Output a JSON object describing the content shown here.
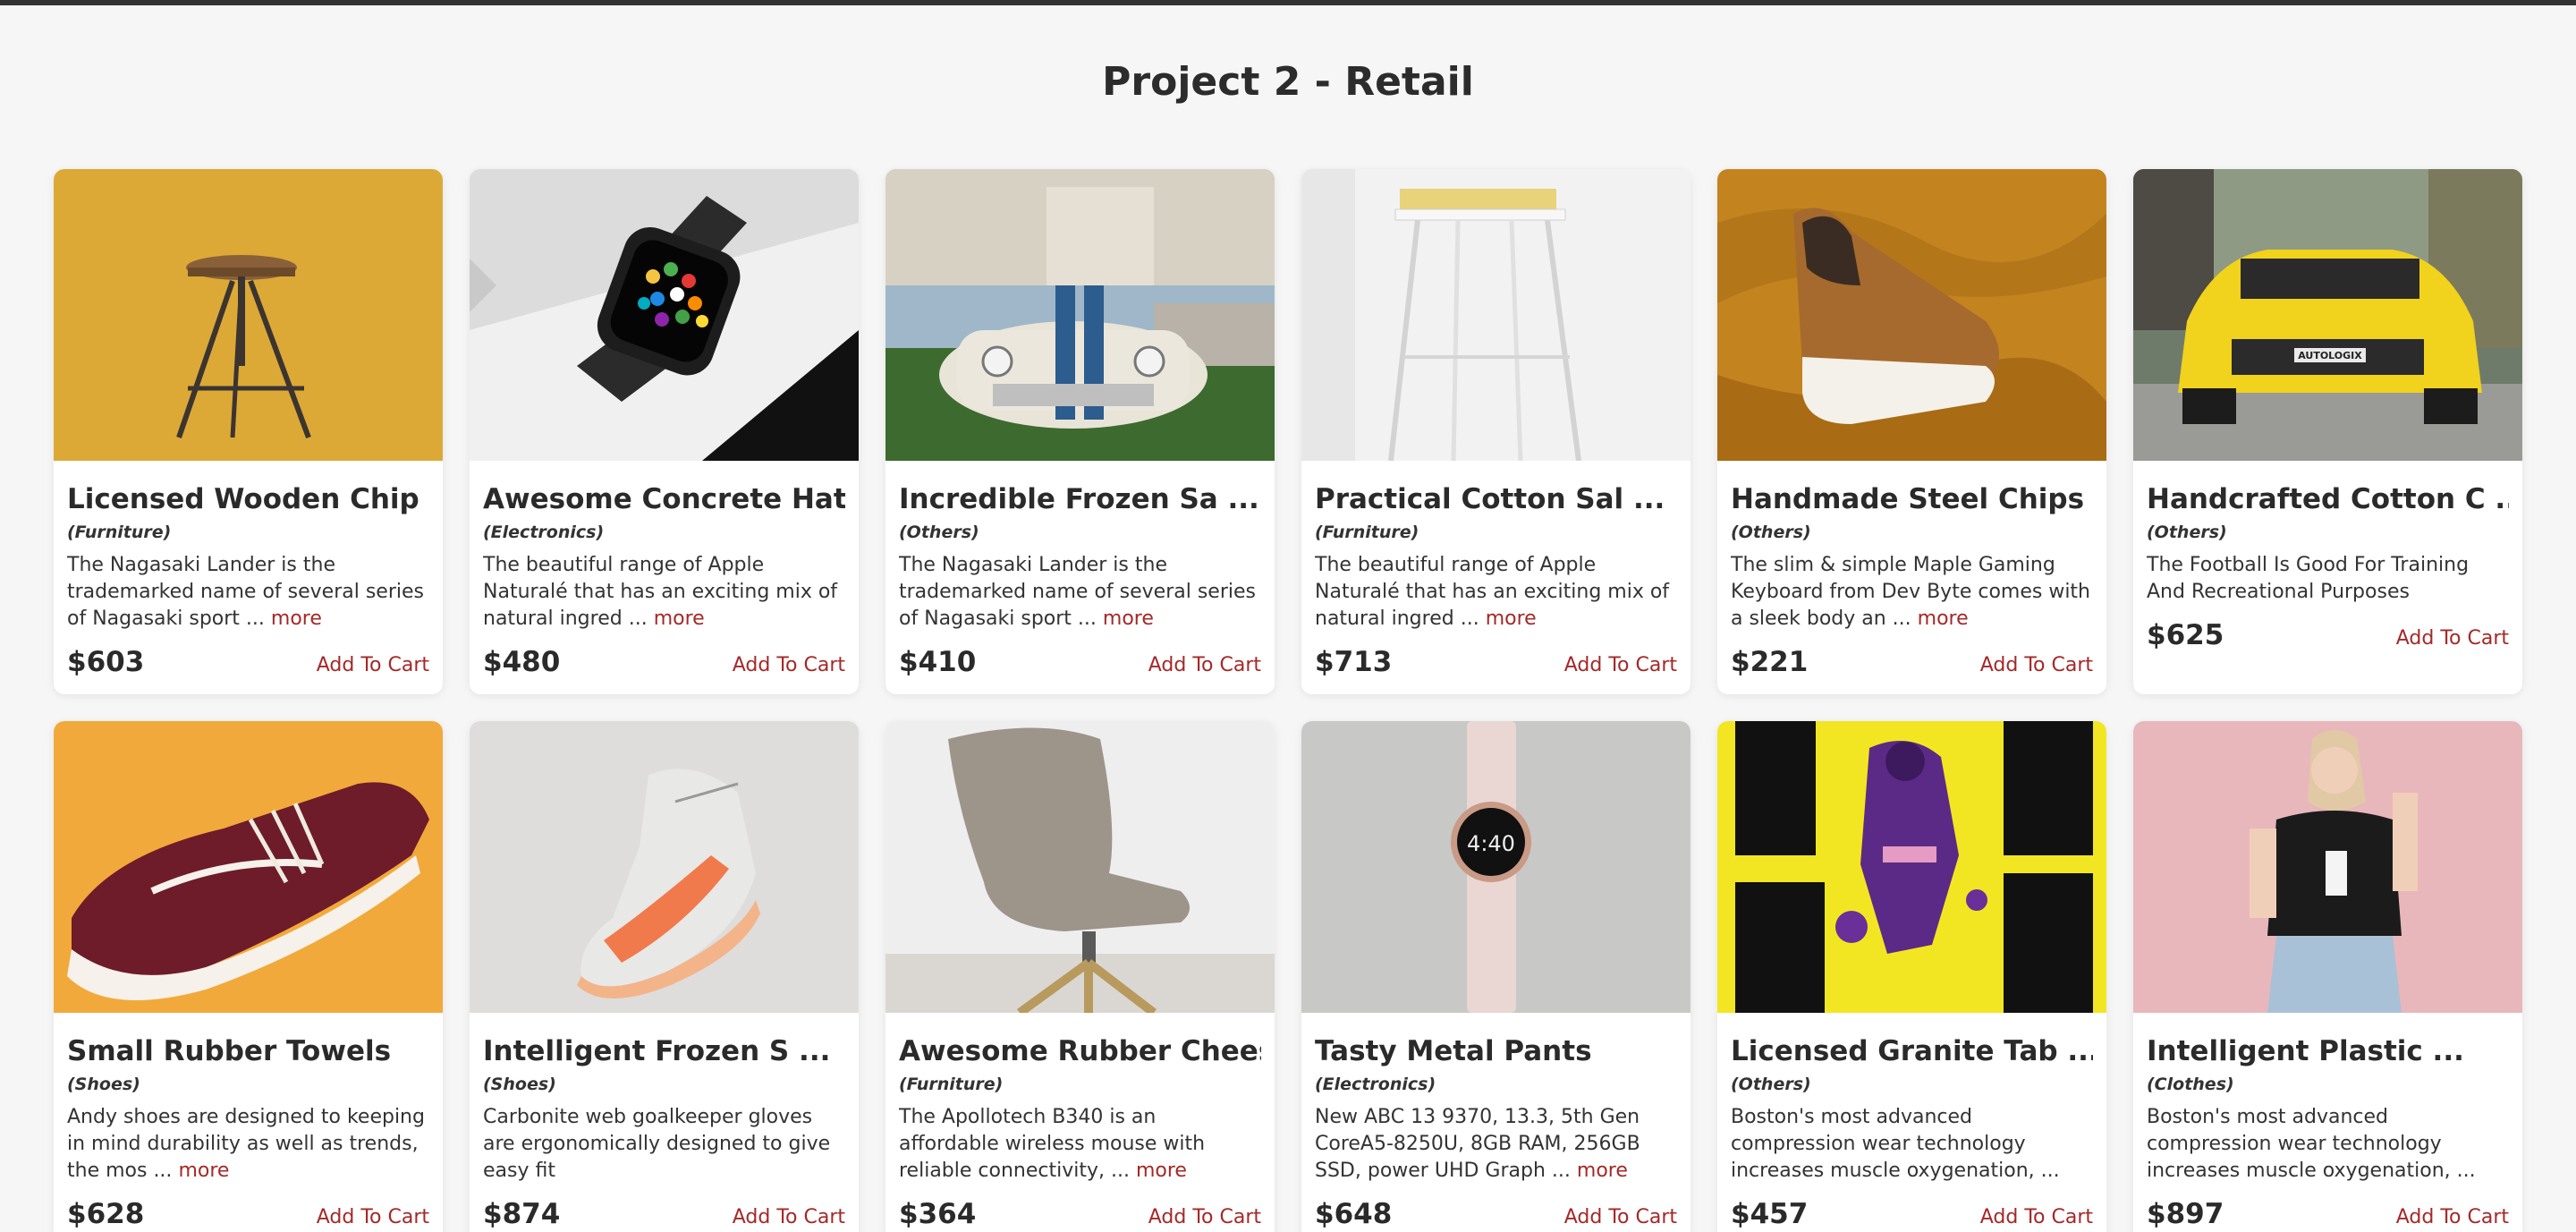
{
  "page": {
    "title": "Project 2 - Retail"
  },
  "products": [
    {
      "name": "Licensed Wooden Chip ...",
      "category": "(Furniture)",
      "description": "The Nagasaki Lander is the trademarked name of several series of Nagasaki sport ...",
      "more": "more",
      "price": "$603",
      "cart": "Add To Cart"
    },
    {
      "name": "Awesome Concrete Hat",
      "category": "(Electronics)",
      "description": "The beautiful range of Apple Naturalé that has an exciting mix of natural ingred ...",
      "more": "more",
      "price": "$480",
      "cart": "Add To Cart"
    },
    {
      "name": "Incredible Frozen Sa ...",
      "category": "(Others)",
      "description": "The Nagasaki Lander is the trademarked name of several series of Nagasaki sport ...",
      "more": "more",
      "price": "$410",
      "cart": "Add To Cart"
    },
    {
      "name": "Practical Cotton Sal ...",
      "category": "(Furniture)",
      "description": "The beautiful range of Apple Naturalé that has an exciting mix of natural ingred ...",
      "more": "more",
      "price": "$713",
      "cart": "Add To Cart"
    },
    {
      "name": "Handmade Steel Chips",
      "category": "(Others)",
      "description": "The slim & simple Maple Gaming Keyboard from Dev Byte comes with a sleek body an ...",
      "more": "more",
      "price": "$221",
      "cart": "Add To Cart"
    },
    {
      "name": "Handcrafted Cotton C ...",
      "category": "(Others)",
      "description": "The Football Is Good For Training And Recreational Purposes",
      "more": "",
      "price": "$625",
      "cart": "Add To Cart"
    },
    {
      "name": "Small Rubber Towels",
      "category": "(Shoes)",
      "description": "Andy shoes are designed to keeping in mind durability as well as trends, the mos ...",
      "more": "more",
      "price": "$628",
      "cart": "Add To Cart"
    },
    {
      "name": "Intelligent Frozen S ...",
      "category": "(Shoes)",
      "description": "Carbonite web goalkeeper gloves are ergonomically designed to give easy fit",
      "more": "",
      "price": "$874",
      "cart": "Add To Cart"
    },
    {
      "name": "Awesome Rubber Chees ...",
      "category": "(Furniture)",
      "description": "The Apollotech B340 is an affordable wireless mouse with reliable connectivity, ...",
      "more": "more",
      "price": "$364",
      "cart": "Add To Cart"
    },
    {
      "name": "Tasty Metal Pants",
      "category": "(Electronics)",
      "description": "New ABC 13 9370, 13.3, 5th Gen CoreA5-8250U, 8GB RAM, 256GB SSD, power UHD Graph ...",
      "more": "more",
      "price": "$648",
      "cart": "Add To Cart"
    },
    {
      "name": "Licensed Granite Tab ...",
      "category": "(Others)",
      "description": "Boston's most advanced compression wear technology increases muscle oxygenation, ...",
      "more": "more",
      "price": "$457",
      "cart": "Add To Cart"
    },
    {
      "name": "Intelligent Plastic ...",
      "category": "(Clothes)",
      "description": "Boston's most advanced compression wear technology increases muscle oxygenation, ...",
      "more": "more",
      "price": "$897",
      "cart": "Add To Cart"
    }
  ],
  "images": {
    "watch_face_time": "4:40",
    "car_plate": "AUTOLOGIX"
  }
}
